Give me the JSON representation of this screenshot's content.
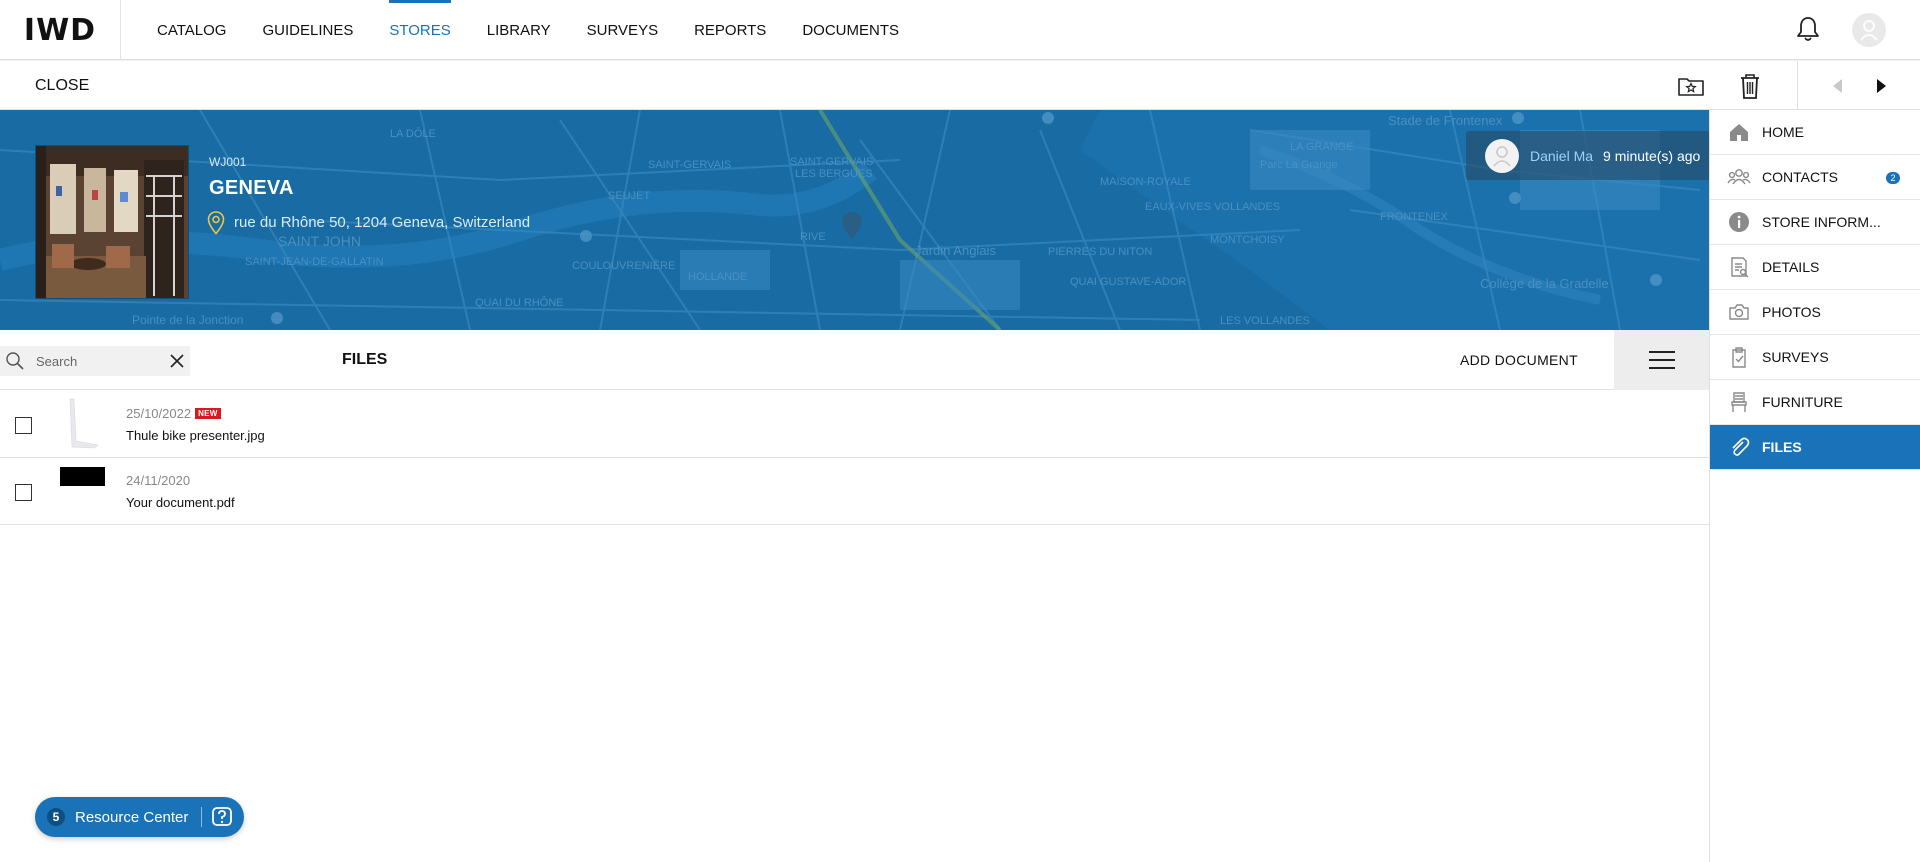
{
  "app": {
    "logo_text": "IWD"
  },
  "nav": {
    "items": [
      {
        "label": "CATALOG",
        "active": false
      },
      {
        "label": "GUIDELINES",
        "active": false
      },
      {
        "label": "STORES",
        "active": true
      },
      {
        "label": "LIBRARY",
        "active": false
      },
      {
        "label": "SURVEYS",
        "active": false
      },
      {
        "label": "REPORTS",
        "active": false
      },
      {
        "label": "DOCUMENTS",
        "active": false
      }
    ],
    "icons": [
      "bell-icon",
      "user-avatar"
    ]
  },
  "toolbar": {
    "close_label": "CLOSE",
    "icons": [
      "folder-star-icon",
      "trash-icon",
      "chevron-left-icon",
      "chevron-right-icon"
    ]
  },
  "store": {
    "code": "WJ001",
    "name": "GENEVA",
    "address": "rue du Rhône 50, 1204 Geneva, Switzerland"
  },
  "last_edit": {
    "user": "Daniel Ma",
    "time": "9 minute(s) ago"
  },
  "map_labels": [
    "LA DÔLE",
    "SAINT-GERVAIS",
    "SAINT-GERVAIS LES BERGUES",
    "SAINT JOHN",
    "SAINT-JEAN-DE-GALLATIN",
    "SEUJET",
    "COULOUVRENIÈRE",
    "HOLLANDE",
    "QUAI DU RHÔNE",
    "Jardin Anglais",
    "PIERRES DU NITON",
    "EAUX-VIVES VOLLANDES",
    "MONTCHOISY",
    "FRONTENEX",
    "Stade de Frontenex",
    "LA GRANGE",
    "Collège de la Gradelle",
    "RIVE",
    "MAISON-ROYALE",
    "QUAI GUSTAVE-ADOR",
    "LES VOLLANDES",
    "Pointe de la Jonction",
    "Parc La Grange"
  ],
  "sidebar": {
    "items": [
      {
        "label": "HOME",
        "icon": "home-icon",
        "active": false
      },
      {
        "label": "CONTACTS",
        "icon": "contacts-icon",
        "active": false,
        "badge": "2"
      },
      {
        "label": "STORE INFORM...",
        "icon": "info-icon",
        "active": false
      },
      {
        "label": "DETAILS",
        "icon": "details-icon",
        "active": false
      },
      {
        "label": "PHOTOS",
        "icon": "camera-icon",
        "active": false
      },
      {
        "label": "SURVEYS",
        "icon": "clipboard-icon",
        "active": false
      },
      {
        "label": "FURNITURE",
        "icon": "chair-icon",
        "active": false
      },
      {
        "label": "FILES",
        "icon": "paperclip-icon",
        "active": true
      }
    ]
  },
  "files": {
    "title": "FILES",
    "search_placeholder": "Search",
    "add_label": "ADD DOCUMENT",
    "rows": [
      {
        "date": "25/10/2022",
        "tag": "NEW",
        "name": "Thule bike presenter.jpg"
      },
      {
        "date": "24/11/2020",
        "tag": "",
        "name": "Your document.pdf"
      }
    ]
  },
  "resource_center": {
    "count": "5",
    "label": "Resource Center"
  },
  "colors": {
    "accent": "#1a73b8",
    "banner": "#186ca3",
    "new_tag": "#d6191c",
    "pin": "#e8c64a"
  }
}
